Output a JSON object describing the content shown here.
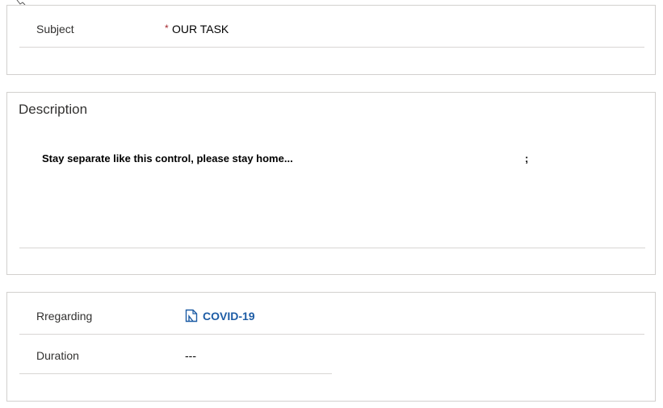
{
  "subject": {
    "label": "Subject",
    "required_mark": "*",
    "value": "OUR TASK"
  },
  "description": {
    "title": "Description",
    "text": "Stay separate like this control, please stay home...",
    "trailing": ";"
  },
  "details": {
    "regarding_label": "Rregarding",
    "regarding_value": "COVID-19",
    "regarding_icon": "record-icon",
    "duration_label": "Duration",
    "duration_value": "---"
  },
  "colors": {
    "border": "#d2d0ce",
    "link": "#1d5ca5",
    "required": "#a4262c"
  }
}
